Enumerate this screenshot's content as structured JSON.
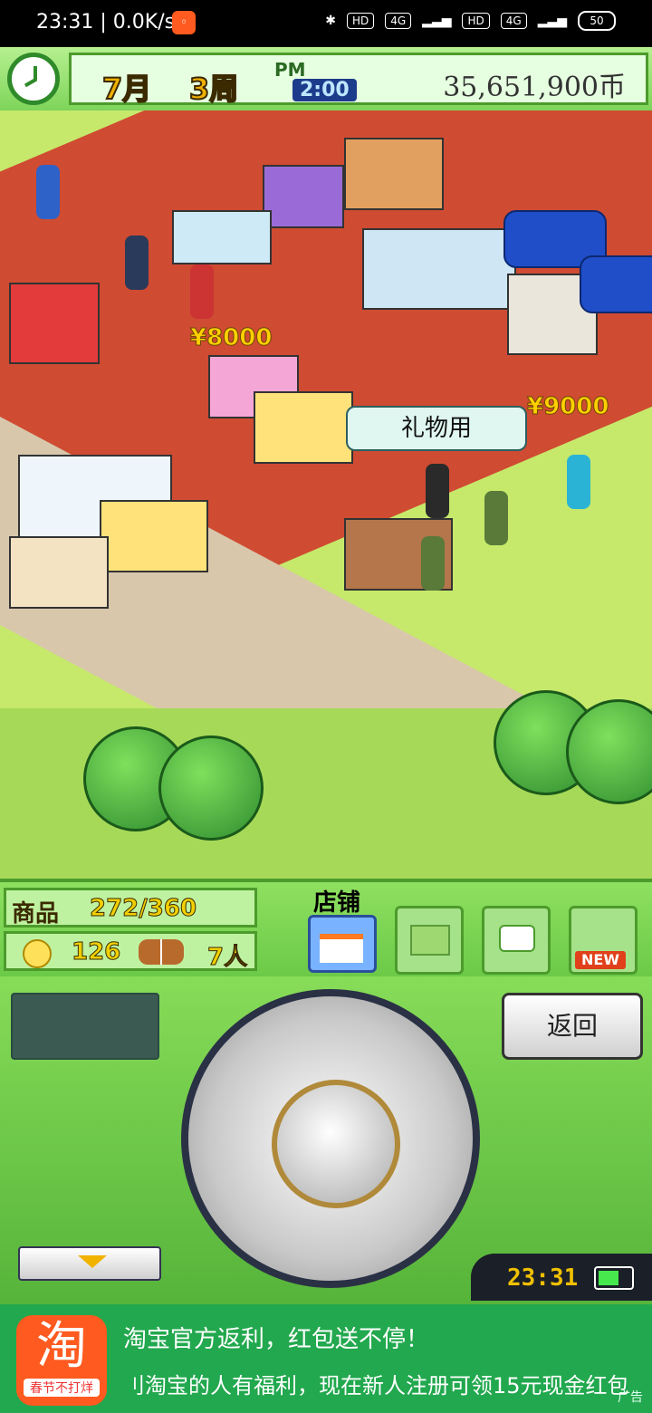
{
  "status_bar": {
    "time_speed": "23:31 | 0.0K/s",
    "chips": [
      "HD",
      "4G",
      "HD",
      "4G"
    ],
    "battery": "50"
  },
  "hud": {
    "month": "7月",
    "week": "3周",
    "ampm": "PM",
    "time": "2:00",
    "money": "35,651,900币"
  },
  "scene": {
    "price_tags": [
      "¥8000",
      "¥9000"
    ],
    "gift_label": "礼物用"
  },
  "stats": {
    "goods_label": "商品",
    "goods_value": "272/360",
    "visitors": "126",
    "staff": "7人"
  },
  "menu": {
    "shop_label": "店铺",
    "new_badge": "NEW"
  },
  "controls": {
    "back_label": "返回",
    "clock": "23:31"
  },
  "ad": {
    "icon_char": "淘",
    "icon_sub": "春节不打烊",
    "title": "淘宝官方返利，红包送不停！",
    "desc": "刂淘宝的人有福利，现在新人注册可领15元现金红包",
    "tag": "广告"
  },
  "colors": {
    "hud_green": "#7ed45a",
    "floor": "#cf4b32",
    "ad_bg": "#22a84e"
  }
}
